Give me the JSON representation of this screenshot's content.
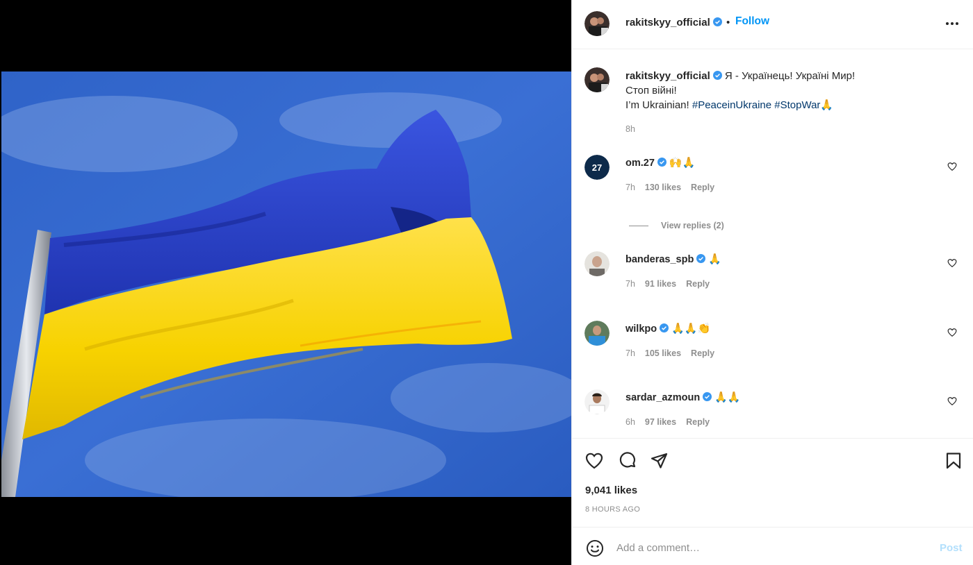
{
  "post": {
    "author": "rakitskyy_official",
    "follow_label": "Follow",
    "separator": "•",
    "caption_line1": " Я - Українець! Україні Мир!",
    "caption_line2": "Стоп війні!",
    "caption_line3_text": "I’m Ukrainian! ",
    "hashtag1": "#PeaceinUkraine",
    "hashtag2": "#StopWar",
    "caption_emoji": "🙏",
    "caption_time": "8h",
    "likes": "9,041 likes",
    "age": "8 HOURS AGO"
  },
  "comments": [
    {
      "user": "om.27",
      "text": "🙌🙏",
      "time": "7h",
      "likes": "130 likes",
      "reply": "Reply"
    },
    {
      "user": "banderas_spb",
      "text": "🙏",
      "time": "7h",
      "likes": "91 likes",
      "reply": "Reply"
    },
    {
      "user": "wilkpo",
      "text": "🙏🙏👏",
      "time": "7h",
      "likes": "105 likes",
      "reply": "Reply"
    },
    {
      "user": "sardar_azmoun",
      "text": "🙏🙏",
      "time": "6h",
      "likes": "97 likes",
      "reply": "Reply"
    }
  ],
  "view_replies": "View replies (2)",
  "om27_avatar_text": "27",
  "composer": {
    "placeholder": "Add a comment…",
    "post_label": "Post"
  },
  "icons": {
    "more": "more-horizontal-icon",
    "like": "heart-icon",
    "comment": "comment-icon",
    "share": "share-icon",
    "save": "bookmark-icon",
    "emoji": "smiley-icon",
    "verified": "verified-badge-icon"
  },
  "colors": {
    "follow": "#0095f6",
    "verified": "#3897f0",
    "hashtag": "#00376b",
    "flag_blue": "#2443c8",
    "flag_yellow": "#ffd500"
  }
}
